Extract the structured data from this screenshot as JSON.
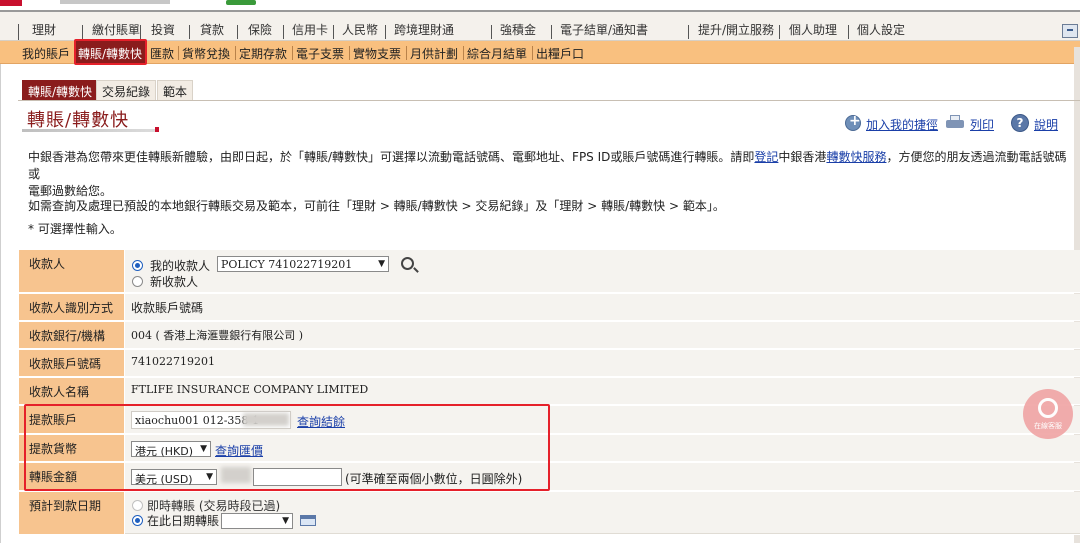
{
  "main_nav": {
    "items": [
      "理財",
      "繳付賬單",
      "投資",
      "貸款",
      "保險",
      "信用卡",
      "人民幣",
      "跨境理財通",
      "強積金",
      "電子結單/通知書",
      "提升/開立服務",
      "個人助理",
      "個人設定"
    ]
  },
  "sub_nav": {
    "items": [
      "我的賬戶",
      "轉賬/轉數快",
      "匯款",
      "貨幣兌換",
      "定期存款",
      "電子支票",
      "實物支票",
      "月供計劃",
      "綜合月結單",
      "出糧戶口"
    ],
    "active": "轉賬/轉數快"
  },
  "tabs": [
    "轉賬/轉數快",
    "交易紀錄",
    "範本"
  ],
  "page_title": "轉賬/轉數快",
  "tools": {
    "bookmark": "加入我的捷徑",
    "print": "列印",
    "help": "說明"
  },
  "description": {
    "para1_a": "中銀香港為您帶來更佳轉賬新體驗，由即日起，於「轉賬/轉數快」可選擇以流動電話號碼、電郵地址、FPS ID或賬戶號碼進行轉賬。請即",
    "para1_link1": "登記",
    "para1_b": "中銀香港",
    "para1_link2": "轉數快服務",
    "para1_c": "，方便您的朋友透過流動電話號碼或",
    "para1_d": "電郵過數給您。",
    "para2": "如需查詢及處理已預設的本地銀行轉賬交易及範本，可前往「理財 > 轉賬/轉數快 > 交易紀錄」及「理財 > 轉賬/轉數快 > 範本」。",
    "para3": "* 可選擇性輸入。"
  },
  "form": {
    "payee": {
      "label": "收款人",
      "option_mine": "我的收款人",
      "selected_payee": "POLICY 741022719201",
      "option_new": "新收款人"
    },
    "payee_id_method": {
      "label": "收款人識別方式",
      "value": "收款賬戶號碼"
    },
    "payee_bank": {
      "label": "收款銀行/機構",
      "value": "004 ( 香港上海滙豐銀行有限公司 )"
    },
    "payee_account": {
      "label": "收款賬戶號碼",
      "value": "741022719201"
    },
    "payee_name": {
      "label": "收款人名稱",
      "value": "FTLIFE INSURANCE COMPANY LIMITED"
    },
    "debit_account": {
      "label": "提款賬戶",
      "value": "xiaochu001 012-358-1",
      "link": "查詢結餘"
    },
    "debit_currency": {
      "label": "提款貨幣",
      "value": "港元 (HKD)",
      "link": "查詢匯價"
    },
    "transfer_amount": {
      "label": "轉賬金額",
      "currency": "美元 (USD)",
      "amount": "",
      "note": "(可準確至兩個小數位，日圓除外)"
    },
    "value_date": {
      "label": "預計到款日期",
      "option_immediate": "即時轉賬 (交易時段已過)",
      "option_date": "在此日期轉賬",
      "date": ""
    }
  },
  "service_bubble": {
    "label": "在線客服"
  },
  "colors": {
    "brand_red": "#8a1c1c",
    "nav_orange": "#f9c07f",
    "label_orange": "#f7c48f",
    "link_blue": "#1a3fa8",
    "highlight_red": "#e5202a"
  }
}
